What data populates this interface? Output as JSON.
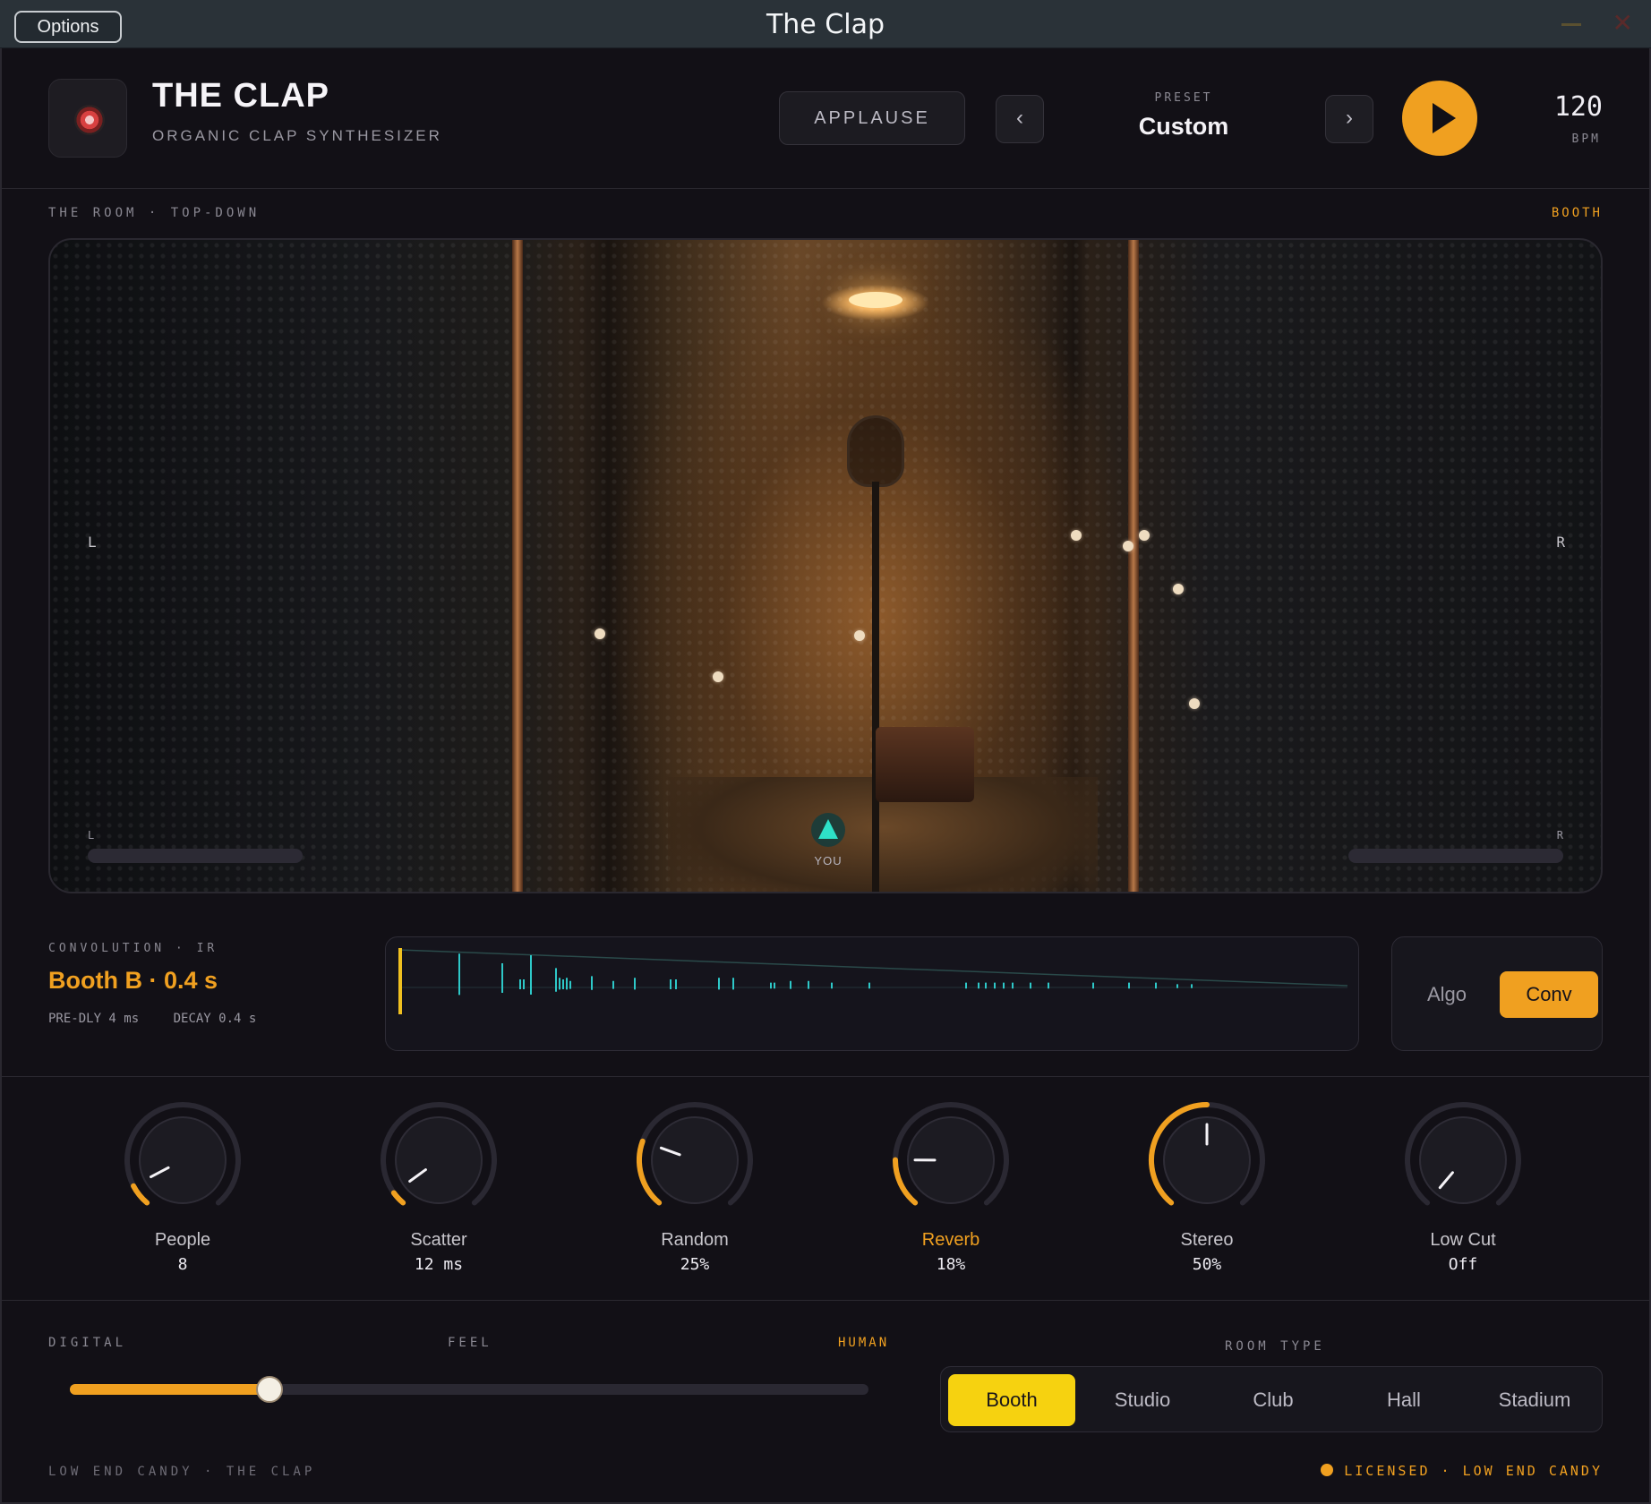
{
  "window": {
    "title": "The Clap",
    "options_label": "Options"
  },
  "header": {
    "title": "THE CLAP",
    "subtitle": "ORGANIC CLAP SYNTHESIZER",
    "preset_category": "APPLAUSE",
    "prev_label": "‹",
    "next_label": "›",
    "preset_label": "PRESET",
    "preset_value": "Custom",
    "bpm_value": "120",
    "bpm_label": "BPM"
  },
  "room": {
    "section_label": "THE ROOM · TOP-DOWN",
    "room_type_label": "BOOTH",
    "left_label": "L",
    "right_label": "R",
    "meter_left_label": "L",
    "meter_right_label": "R",
    "listener_label": "YOU"
  },
  "convolution": {
    "section_label": "CONVOLUTION · IR",
    "ir_name": "Booth B · 0.4 s",
    "pre_delay": "PRE-DLY 4 ms",
    "decay": "DECAY 0.4 s",
    "modes": [
      "Algo",
      "Conv"
    ],
    "active_mode": "Conv"
  },
  "knobs": [
    {
      "label": "People",
      "value": "8",
      "level": 0.08,
      "active": false
    },
    {
      "label": "Scatter",
      "value": "12 ms",
      "level": 0.05,
      "active": false
    },
    {
      "label": "Random",
      "value": "25%",
      "level": 0.25,
      "active": false
    },
    {
      "label": "Reverb",
      "value": "18%",
      "level": 0.18,
      "active": true
    },
    {
      "label": "Stereo",
      "value": "50%",
      "level": 0.5,
      "active": false
    },
    {
      "label": "Low Cut",
      "value": "Off",
      "level": 0.0,
      "active": false
    }
  ],
  "feel": {
    "left_label": "DIGITAL",
    "center_label": "FEEL",
    "right_label": "HUMAN",
    "value": 0.25
  },
  "room_type": {
    "label": "ROOM TYPE",
    "options": [
      "Booth",
      "Studio",
      "Club",
      "Hall",
      "Stadium"
    ],
    "selected": "Booth"
  },
  "footer": {
    "left": "LOW END CANDY · THE CLAP",
    "right": "LICENSED · LOW END CANDY"
  },
  "colors": {
    "accent": "#f0a020",
    "room_type_active": "#f6d210",
    "ir_spikes": "#2ec8c8",
    "background": "#121016"
  }
}
